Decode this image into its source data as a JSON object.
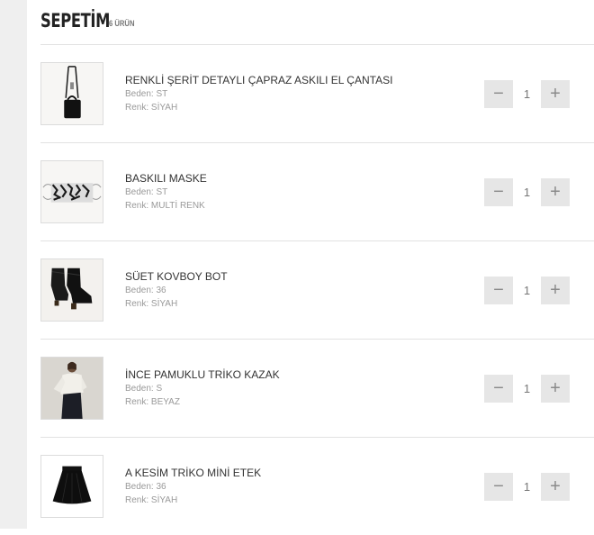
{
  "cart": {
    "title": "SEPETİM",
    "count": "6 ÜRÜN"
  },
  "labels": {
    "size_prefix": "Beden:",
    "color_prefix": "Renk:"
  },
  "items": [
    {
      "name": "RENKLİ ŞERİT DETAYLI ÇAPRAZ ASKILI EL ÇANTASI",
      "size": "Beden: ST",
      "color": "Renk: SİYAH",
      "qty": "1",
      "image": "handbag"
    },
    {
      "name": "BASKILI MASKE",
      "size": "Beden: ST",
      "color": "Renk: MULTİ RENK",
      "qty": "1",
      "image": "face-mask"
    },
    {
      "name": "SÜET KOVBOY BOT",
      "size": "Beden: 36",
      "color": "Renk: SİYAH",
      "qty": "1",
      "image": "boots"
    },
    {
      "name": "İNCE PAMUKLU TRİKO KAZAK",
      "size": "Beden: S",
      "color": "Renk: BEYAZ",
      "qty": "1",
      "image": "model-sweater"
    },
    {
      "name": "A KESİM TRİKO MİNİ ETEK",
      "size": "Beden: 36",
      "color": "Renk: SİYAH",
      "qty": "1",
      "image": "skirt"
    }
  ],
  "controls": {
    "minus": "−",
    "plus": "+"
  }
}
